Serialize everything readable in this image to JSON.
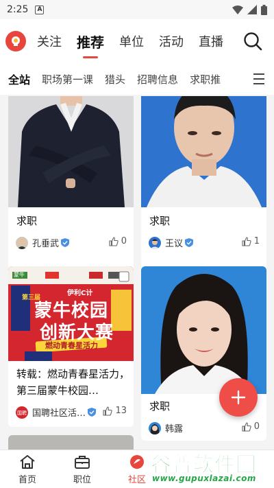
{
  "status_bar": {
    "time": "2:25",
    "notif_letter": "A"
  },
  "top_tabs": [
    "关注",
    "推荐",
    "单位",
    "活动",
    "直播"
  ],
  "sub_tabs": [
    "全站",
    "职场第一课",
    "猎头",
    "招聘信息",
    "求职推"
  ],
  "cards": [
    {
      "title": "求职",
      "user": "孔垂武",
      "likes": "0"
    },
    {
      "title": "求职",
      "user": "王议",
      "likes": "1"
    },
    {
      "title": "转载：燃动青春星活力，第三届蒙牛校园…",
      "user": "国聘社区活…",
      "likes": "13",
      "poster": {
        "top_left": "蒙牛",
        "mid": "伊利C计",
        "tag": "第三届",
        "line1": "蒙牛校园",
        "line2": "创新大赛",
        "slogan": "燃动青春星活力"
      }
    },
    {
      "title": "求职",
      "user": "韩露",
      "likes": "0"
    }
  ],
  "bottom_nav": [
    "首页",
    "职位",
    "社区"
  ],
  "watermark": {
    "text": "谷普软件园",
    "url": "www.gupuxlazai.com"
  },
  "colors": {
    "accent": "#e8463d",
    "badge": "#4a90e2"
  }
}
